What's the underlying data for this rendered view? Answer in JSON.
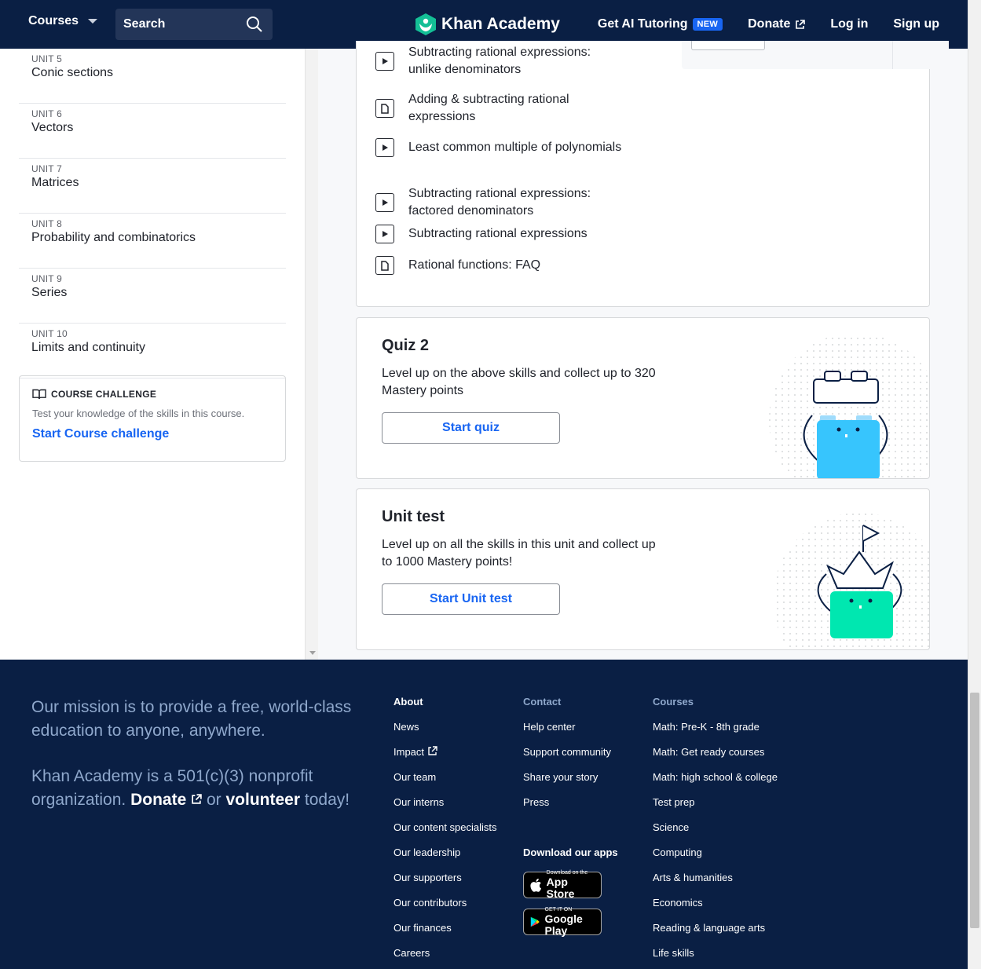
{
  "header": {
    "courses_label": "Courses",
    "search_placeholder": "Search",
    "logo_text": "Khan Academy",
    "ai_tutoring": "Get AI Tutoring",
    "new_badge": "NEW",
    "donate": "Donate",
    "login": "Log in",
    "signup": "Sign up"
  },
  "sidebar": {
    "units": [
      {
        "label": "UNIT 5",
        "title": "Conic sections"
      },
      {
        "label": "UNIT 6",
        "title": "Vectors"
      },
      {
        "label": "UNIT 7",
        "title": "Matrices"
      },
      {
        "label": "UNIT 8",
        "title": "Probability and combinatorics"
      },
      {
        "label": "UNIT 9",
        "title": "Series"
      },
      {
        "label": "UNIT 10",
        "title": "Limits and continuity"
      }
    ],
    "challenge": {
      "heading": "COURSE CHALLENGE",
      "description": "Test your knowledge of the skills in this course.",
      "link": "Start Course challenge"
    }
  },
  "lessons": [
    {
      "type": "video",
      "title": "Subtracting rational expressions: unlike denominators"
    },
    {
      "type": "article",
      "title": "Adding & subtracting rational expressions"
    },
    {
      "type": "video",
      "title": "Least common multiple of polynomials"
    },
    {
      "type": "video",
      "title": "Subtracting rational expressions: factored denominators"
    },
    {
      "type": "video",
      "title": "Subtracting rational expressions"
    },
    {
      "type": "article",
      "title": "Rational functions: FAQ"
    }
  ],
  "quiz": {
    "title": "Quiz 2",
    "description": "Level up on the above skills and collect up to 320 Mastery points",
    "button": "Start quiz"
  },
  "unit_test": {
    "title": "Unit test",
    "description": "Level up on all the skills in this unit and collect up to 1000 Mastery points!",
    "button": "Start Unit test"
  },
  "footer": {
    "mission": "Our mission is to provide a free, world-class education to anyone, anywhere.",
    "nonprofit_pre": "Khan Academy is a 501(c)(3) nonprofit organization.",
    "donate": "Donate",
    "or": "or",
    "volunteer": "volunteer",
    "today": "today!",
    "about": {
      "heading": "About",
      "links": [
        "News",
        "Impact",
        "Our team",
        "Our interns",
        "Our content specialists",
        "Our leadership",
        "Our supporters",
        "Our contributors",
        "Our finances",
        "Careers"
      ]
    },
    "contact": {
      "heading": "Contact",
      "links": [
        "Help center",
        "Support community",
        "Share your story",
        "Press"
      ]
    },
    "apps": {
      "heading": "Download our apps",
      "app_store_small": "Download on the",
      "app_store_big": "App Store",
      "google_small": "GET IT ON",
      "google_big": "Google Play"
    },
    "courses": {
      "heading": "Courses",
      "links": [
        "Math: Pre-K - 8th grade",
        "Math: Get ready courses",
        "Math: high school & college",
        "Test prep",
        "Science",
        "Computing",
        "Arts & humanities",
        "Economics",
        "Reading & language arts",
        "Life skills"
      ]
    }
  },
  "colors": {
    "navy": "#0a1f44",
    "blue": "#1865f2",
    "quiz_character": "#37c5fd",
    "test_character": "#00e7b0"
  }
}
